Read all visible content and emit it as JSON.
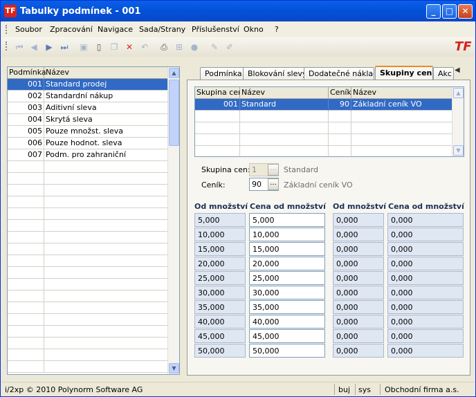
{
  "window": {
    "title": "Tabulky podmínek - 001",
    "logo": "TF"
  },
  "menu": [
    "Soubor",
    "Zpracování",
    "Navigace",
    "Sada/Strany",
    "Příslušenství",
    "Okno",
    "?"
  ],
  "toolbar": {
    "icons": [
      "first-record-icon",
      "prev-record-icon",
      "next-record-icon",
      "last-record-icon",
      "save-icon",
      "new-doc-icon",
      "copy-icon",
      "delete-icon",
      "undo-icon",
      "print-icon",
      "tree-icon",
      "lock-icon",
      "edit-icon",
      "pen-icon"
    ]
  },
  "conditions": {
    "columns": [
      "Podmínka",
      "Název"
    ],
    "rows": [
      {
        "code": "001",
        "name": "Standard prodej"
      },
      {
        "code": "002",
        "name": "Standardní nákup"
      },
      {
        "code": "003",
        "name": "Aditivní sleva"
      },
      {
        "code": "004",
        "name": "Skrytá sleva"
      },
      {
        "code": "005",
        "name": "Pouze množst. sleva"
      },
      {
        "code": "006",
        "name": "Pouze hodnot. sleva"
      },
      {
        "code": "007",
        "name": "Podm. pro zahraniční"
      }
    ],
    "selected": 0
  },
  "tabs": [
    "Podmínka",
    "Blokování slevy",
    "Dodatečné náklady",
    "Skupiny cen",
    "Akc"
  ],
  "active_tab": "Skupiny cen",
  "price_groups": {
    "columns": [
      "Skupina cen",
      "Název",
      "Ceník",
      "Název"
    ],
    "rows": [
      {
        "group": "001",
        "name": "Standard",
        "pricelist": "90",
        "pricelist_name": "Základní ceník VO"
      }
    ]
  },
  "form": {
    "group_label": "Skupina cen:",
    "group_value": "1",
    "group_name": "Standard",
    "pricelist_label": "Ceník:",
    "pricelist_value": "90",
    "pricelist_name": "Základní ceník VO",
    "dots": "..."
  },
  "quantity_table": {
    "headers": [
      "Od množství",
      "Cena od množství",
      "Od množství",
      "Cena od množství"
    ],
    "from_qty": [
      "5,000",
      "10,000",
      "15,000",
      "20,000",
      "25,000",
      "30,000",
      "35,000",
      "40,000",
      "45,000",
      "50,000"
    ],
    "price_from_qty": [
      "5,000",
      "10,000",
      "15,000",
      "20,000",
      "25,000",
      "30,000",
      "35,000",
      "40,000",
      "45,000",
      "50,000"
    ],
    "from_qty_2": [
      "0,000",
      "0,000",
      "0,000",
      "0,000",
      "0,000",
      "0,000",
      "0,000",
      "0,000",
      "0,000",
      "0,000"
    ],
    "price_from_qty_2": [
      "0,000",
      "0,000",
      "0,000",
      "0,000",
      "0,000",
      "0,000",
      "0,000",
      "0,000",
      "0,000",
      "0,000"
    ]
  },
  "status": {
    "copyright": "i/2xp © 2010 Polynorm Software AG",
    "mode": "buj",
    "user": "sys",
    "company": "Obchodní firma a.s."
  }
}
